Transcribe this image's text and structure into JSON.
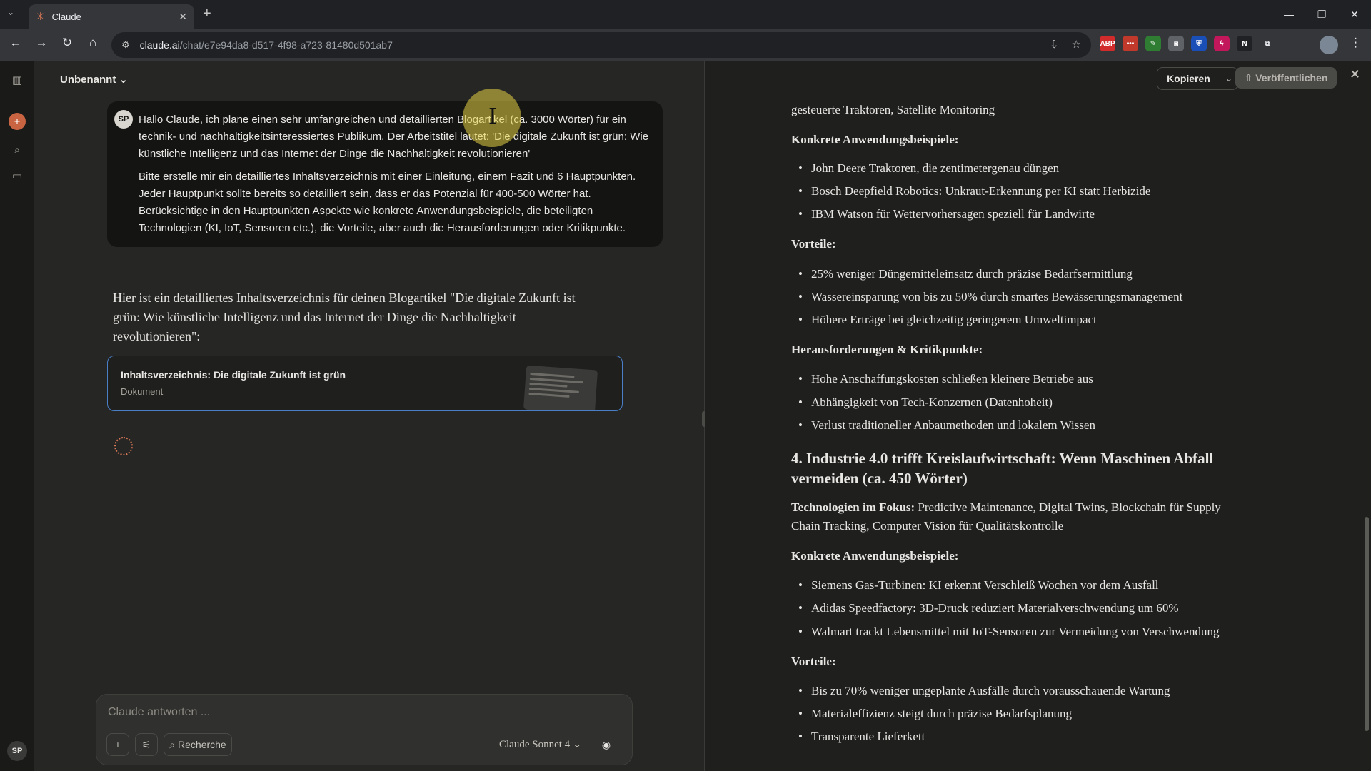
{
  "browser": {
    "tab_title": "Claude",
    "url_host": "claude.ai",
    "url_path": "/chat/e7e94da8-d517-4f98-a723-81480d501ab7",
    "extensions": [
      {
        "name": "abp-extension-icon",
        "label": "ABP",
        "color": "#d12b2b"
      },
      {
        "name": "dots-extension-icon",
        "label": "•••",
        "color": "#c0392b"
      },
      {
        "name": "pen-extension-icon",
        "label": "✎",
        "color": "#2e7d32"
      },
      {
        "name": "camera-extension-icon",
        "label": "◙",
        "color": "#5f6368"
      },
      {
        "name": "shield-extension-icon",
        "label": "⛨",
        "color": "#1a4fb8"
      },
      {
        "name": "flash-extension-icon",
        "label": "ϟ",
        "color": "#c2185b"
      },
      {
        "name": "notion-extension-icon",
        "label": "N",
        "color": "#202124"
      }
    ]
  },
  "chat": {
    "title": "Unbenannt",
    "user_initials": "SP",
    "user_paragraphs": [
      "Hallo Claude, ich plane einen sehr umfangreichen und detaillierten Blogartikel (ca. 3000 Wörter) für ein technik- und nachhaltigkeitsinteressiertes Publikum. Der Arbeitstitel lautet: 'Die digitale Zukunft ist grün: Wie künstliche Intelligenz und das Internet der Dinge die Nachhaltigkeit revolutionieren'",
      "Bitte erstelle mir ein detailliertes Inhaltsverzeichnis mit einer Einleitung, einem Fazit und 6 Hauptpunkten. Jeder Hauptpunkt sollte bereits so detailliert sein, dass er das Potenzial für 400-500 Wörter hat. Berücksichtige in den Hauptpunkten Aspekte wie konkrete Anwendungsbeispiele, die beteiligten Technologien (KI, IoT, Sensoren etc.), die Vorteile, aber auch die Herausforderungen oder Kritikpunkte."
    ],
    "assistant_intro": "Hier ist ein detailliertes Inhaltsverzeichnis für deinen Blogartikel \"Die digitale Zukunft ist grün: Wie künstliche Intelligenz und das Internet der Dinge die Nachhaltigkeit revolutionieren\":",
    "artifact_title": "Inhaltsverzeichnis: Die digitale Zukunft ist grün",
    "artifact_type": "Dokument",
    "composer_placeholder": "Claude antworten ...",
    "research_label": "Recherche",
    "model_label": "Claude Sonnet 4"
  },
  "panel": {
    "copy_label": "Kopieren",
    "publish_label": "Veröffentlichen",
    "doc": {
      "top_fragment": "gesteuerte Traktoren, Satellite Monitoring",
      "s3_examples_heading": "Konkrete Anwendungsbeispiele:",
      "s3_examples": [
        "John Deere Traktoren, die zentimetergenau düngen",
        "Bosch Deepfield Robotics: Unkraut-Erkennung per KI statt Herbizide",
        "IBM Watson für Wettervorhersagen speziell für Landwirte"
      ],
      "s3_advantages_heading": "Vorteile:",
      "s3_advantages": [
        "25% weniger Düngemitteleinsatz durch präzise Bedarfsermittlung",
        "Wassereinsparung von bis zu 50% durch smartes Bewässerungsmanagement",
        "Höhere Erträge bei gleichzeitig geringerem Umweltimpact"
      ],
      "s3_challenges_heading": "Herausforderungen & Kritikpunkte:",
      "s3_challenges": [
        "Hohe Anschaffungskosten schließen kleinere Betriebe aus",
        "Abhängigkeit von Tech-Konzernen (Datenhoheit)",
        "Verlust traditioneller Anbaumethoden und lokalem Wissen"
      ],
      "s4_heading": "4. Industrie 4.0 trifft Kreislaufwirtschaft: Wenn Maschinen Abfall vermeiden (ca. 450 Wörter)",
      "s4_tech_label": "Technologien im Fokus:",
      "s4_tech_line1": "Predictive Maintenance, Digital Twins, Blockchain für Supply",
      "s4_tech_line2": "Chain Tracking, Computer Vision für Qualitätskontrolle",
      "s4_examples_heading": "Konkrete Anwendungsbeispiele:",
      "s4_examples": [
        "Siemens Gas-Turbinen: KI erkennt Verschleiß Wochen vor dem Ausfall",
        "Adidas Speedfactory: 3D-Druck reduziert Materialverschwendung um 60%",
        "Walmart trackt Lebensmittel mit IoT-Sensoren zur Vermeidung von Verschwendung"
      ],
      "s4_advantages_heading": "Vorteile:",
      "s4_advantages": [
        "Bis zu 70% weniger ungeplante Ausfälle durch vorausschauende Wartung",
        "Materialeffizienz steigt durch präzise Bedarfsplanung",
        "Transparente Lieferkett"
      ]
    }
  }
}
